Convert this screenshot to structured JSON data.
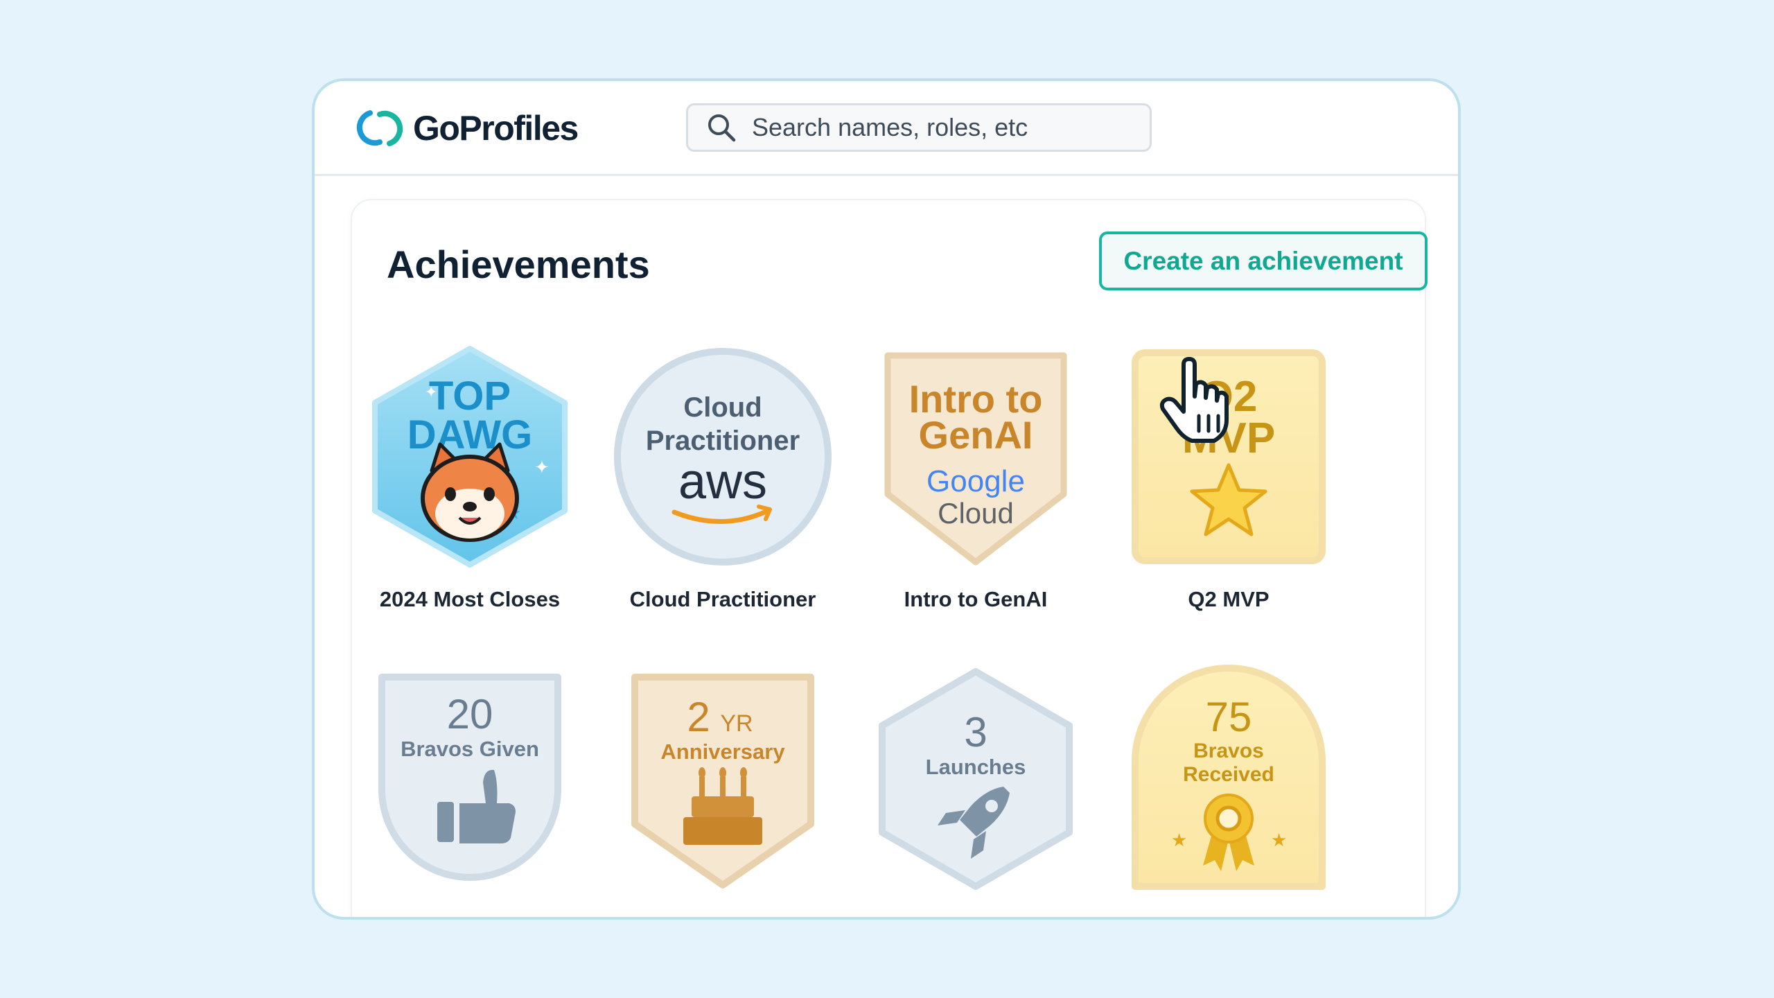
{
  "brand": {
    "name": "GoProfiles"
  },
  "search": {
    "placeholder": "Search names, roles, etc"
  },
  "page": {
    "title": "Achievements",
    "create_button_label": "Create an achievement"
  },
  "colors": {
    "accent": "#18b6a0",
    "background": "#e5f3fc",
    "brand_blue": "#1a9bd8"
  },
  "badges": [
    {
      "label": "2024 Most Closes",
      "text_line1": "TOP",
      "text_line2": "DAWG",
      "icon": "dog-face-icon"
    },
    {
      "label": "Cloud Practitioner",
      "text_line1": "Cloud",
      "text_line2": "Practitioner",
      "brand_text": "aws",
      "icon": "aws-logo-icon"
    },
    {
      "label": "Intro to GenAI",
      "text_line1": "Intro to",
      "text_line2": "GenAI",
      "brand_text": "Google",
      "brand_sub": "Cloud",
      "icon": "google-cloud-icon"
    },
    {
      "label": "Q2 MVP",
      "text_line1": "Q2",
      "text_line2": "MVP",
      "icon": "star-icon"
    },
    {
      "label": "",
      "number": "20",
      "text_line1": "Bravos Given",
      "icon": "thumbs-up-icon"
    },
    {
      "label": "",
      "number": "2",
      "unit": "YR",
      "text_line1": "Anniversary",
      "icon": "cake-icon"
    },
    {
      "label": "",
      "number": "3",
      "text_line1": "Launches",
      "icon": "rocket-icon"
    },
    {
      "label": "",
      "number": "75",
      "text_line1": "Bravos",
      "text_line2": "Received",
      "icon": "medal-ribbon-icon"
    }
  ]
}
